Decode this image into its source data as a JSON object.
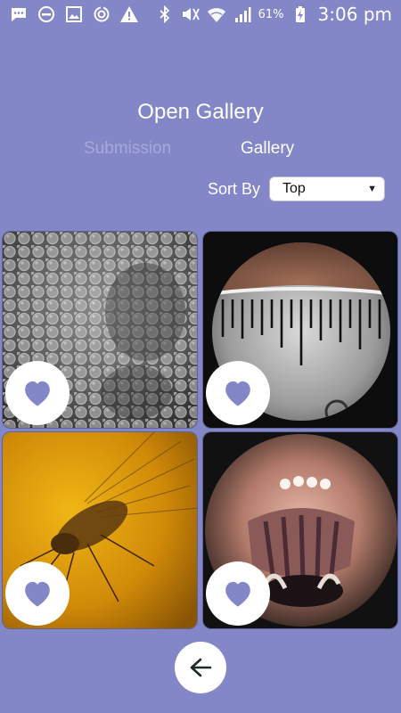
{
  "status_bar": {
    "left_icons": [
      "message-icon",
      "do-not-disturb-icon",
      "image-icon",
      "sync-icon",
      "warning-icon"
    ],
    "right_icons": [
      "bluetooth-icon",
      "mute-icon",
      "wifi-icon",
      "signal-icon",
      "battery-charging-icon"
    ],
    "battery_percent": "61%",
    "time": "3:06 pm"
  },
  "page": {
    "title": "Open Gallery"
  },
  "tabs": {
    "items": [
      {
        "label": "Submission",
        "active": false
      },
      {
        "label": "Gallery",
        "active": true
      }
    ]
  },
  "sort": {
    "label": "Sort By",
    "selected": "Top"
  },
  "gallery": {
    "photos": [
      {
        "subject": "bubbles",
        "favorite_icon": "heart-icon"
      },
      {
        "subject": "ruler",
        "favorite_icon": "heart-icon"
      },
      {
        "subject": "insect-in-amber",
        "favorite_icon": "heart-icon"
      },
      {
        "subject": "spider",
        "favorite_icon": "heart-icon"
      }
    ]
  },
  "navigation": {
    "back_icon": "arrow-left-icon"
  },
  "colors": {
    "background": "#8387c7",
    "accent": "#8387c7",
    "inactive_tab": "#a5a8d8",
    "text": "#ffffff"
  }
}
